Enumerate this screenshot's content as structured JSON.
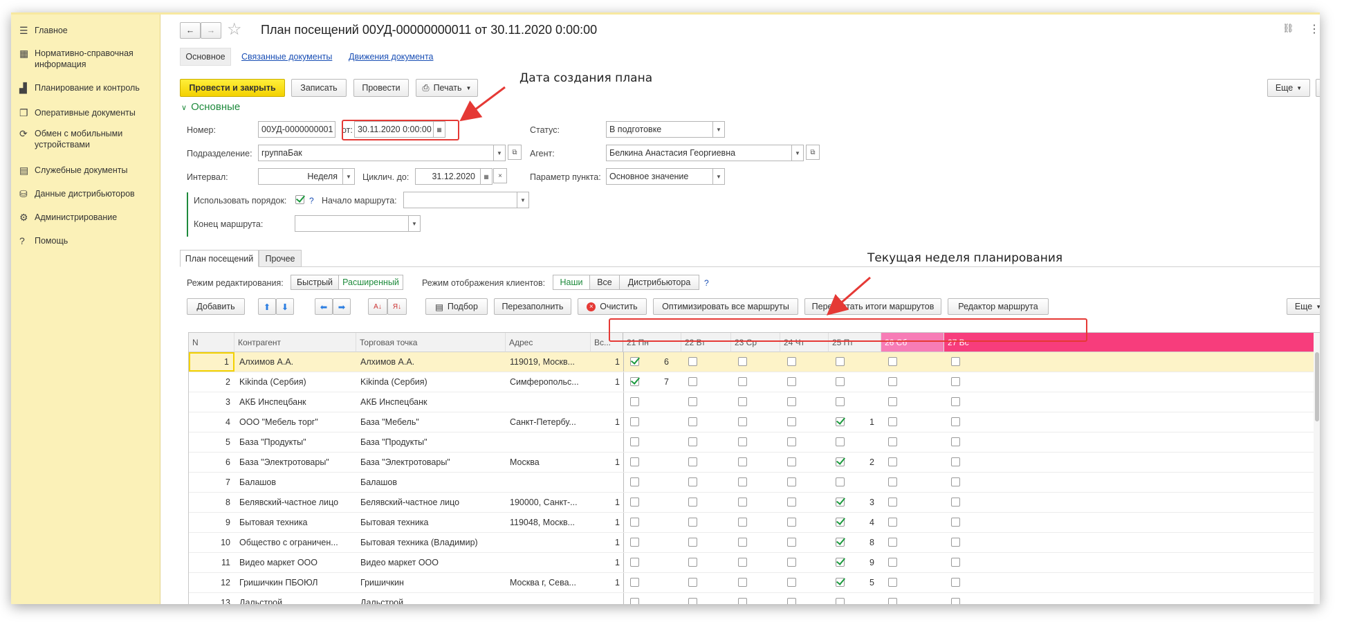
{
  "sidebar": {
    "items": [
      {
        "icon": "menu-icon",
        "glyph": "☰",
        "label": "Главное"
      },
      {
        "icon": "grid-icon",
        "glyph": "▦",
        "label": "Нормативно-справочная информация"
      },
      {
        "icon": "chart-icon",
        "glyph": "▟",
        "label": "Планирование и контроль"
      },
      {
        "icon": "documents-icon",
        "glyph": "❐",
        "label": "Оперативные документы"
      },
      {
        "icon": "sync-icon",
        "glyph": "⟳",
        "label": "Обмен с мобильными устройствами"
      },
      {
        "icon": "service-docs-icon",
        "glyph": "▤",
        "label": "Служебные документы"
      },
      {
        "icon": "distributor-icon",
        "glyph": "⛁",
        "label": "Данные дистрибьюторов"
      },
      {
        "icon": "gear-icon",
        "glyph": "⚙",
        "label": "Администрирование"
      },
      {
        "icon": "help-icon",
        "glyph": "?",
        "label": "Помощь"
      }
    ]
  },
  "header": {
    "title": "План посещений 00УД-00000000011 от 30.11.2020 0:00:00",
    "back_glyph": "←",
    "forward_glyph": "→",
    "star_glyph": "☆",
    "link_glyph": "🔗",
    "more_glyph": "⋮",
    "close_glyph": "×"
  },
  "doc_tabs": {
    "main": "Основное",
    "linked": "Связанные документы",
    "movements": "Движения документа"
  },
  "toolbar": {
    "post_close": "Провести и закрыть",
    "save": "Записать",
    "post": "Провести",
    "print": "Печать",
    "more": "Еще",
    "help": "?"
  },
  "section": {
    "title": "Основные"
  },
  "form": {
    "number_label": "Номер:",
    "number_value": "00УД-0000000001",
    "from_label": "от:",
    "date_value": "30.11.2020  0:00:00",
    "status_label": "Статус:",
    "status_value": "В подготовке",
    "department_label": "Подразделение:",
    "department_value": "группаБак",
    "agent_label": "Агент:",
    "agent_value": "Белкина Анастасия Георгиевна",
    "interval_label": "Интервал:",
    "interval_value": "Неделя",
    "cyclic_label": "Циклич. до:",
    "cyclic_value": "31.12.2020",
    "point_param_label": "Параметр пункта:",
    "point_param_value": "Основное значение",
    "use_order_label": "Использовать порядок:",
    "use_order_help": "?",
    "route_start_label": "Начало маршрута:",
    "route_end_label": "Конец маршрута:"
  },
  "plan_tabs": {
    "visits": "План посещений",
    "other": "Прочее"
  },
  "modes": {
    "edit_label": "Режим редактирования:",
    "edit_fast": "Быстрый",
    "edit_extended": "Расширенный",
    "display_label": "Режим отображения клиентов:",
    "display_ours": "Наши",
    "display_all": "Все",
    "display_distributor": "Дистрибьютора",
    "help": "?"
  },
  "table_toolbar": {
    "add": "Добавить",
    "selection": "Подбор",
    "refill": "Перезаполнить",
    "clear": "Очистить",
    "optimize": "Оптимизировать все маршруты",
    "recalc": "Пересчитать итоги маршрутов",
    "route_editor": "Редактор маршрута",
    "more": "Еще"
  },
  "columns": {
    "n": "N",
    "counterparty": "Контрагент",
    "outlet": "Торговая точка",
    "address": "Адрес",
    "total": "Вс..."
  },
  "days": [
    "21 Пн",
    "22 Вт",
    "23 Ср",
    "24 Чт",
    "25 Пт",
    "26 Сб",
    "27 Вс"
  ],
  "colors": {
    "saturday": "#f77cb6",
    "sunday": "#f73d7c",
    "accent": "#1e8a3c",
    "yellow": "#f3d100",
    "annotation": "#e53935"
  },
  "rows": [
    {
      "n": "1",
      "counterparty": "Алхимов А.А.",
      "outlet": "Алхимов А.А.",
      "address": "119019, Москв...",
      "total": "1",
      "checks": [
        true,
        false,
        false,
        false,
        false,
        false,
        false
      ],
      "order": "6"
    },
    {
      "n": "2",
      "counterparty": "Kikinda (Сербия)",
      "outlet": "Kikinda (Сербия)",
      "address": "Симферопольс...",
      "total": "1",
      "checks": [
        true,
        false,
        false,
        false,
        false,
        false,
        false
      ],
      "order": "7"
    },
    {
      "n": "3",
      "counterparty": "АКБ Инспецбанк",
      "outlet": "АКБ Инспецбанк",
      "address": "",
      "total": "",
      "checks": [
        false,
        false,
        false,
        false,
        false,
        false,
        false
      ],
      "order": ""
    },
    {
      "n": "4",
      "counterparty": "ООО \"Мебель торг\"",
      "outlet": "База \"Мебель\"",
      "address": "Санкт-Петербу...",
      "total": "1",
      "checks": [
        false,
        false,
        false,
        false,
        true,
        false,
        false
      ],
      "order": "1"
    },
    {
      "n": "5",
      "counterparty": "База \"Продукты\"",
      "outlet": "База \"Продукты\"",
      "address": "",
      "total": "",
      "checks": [
        false,
        false,
        false,
        false,
        false,
        false,
        false
      ],
      "order": ""
    },
    {
      "n": "6",
      "counterparty": "База \"Электротовары\"",
      "outlet": "База \"Электротовары\"",
      "address": "Москва",
      "total": "1",
      "checks": [
        false,
        false,
        false,
        false,
        true,
        false,
        false
      ],
      "order": "2"
    },
    {
      "n": "7",
      "counterparty": "Балашов",
      "outlet": "Балашов",
      "address": "",
      "total": "",
      "checks": [
        false,
        false,
        false,
        false,
        false,
        false,
        false
      ],
      "order": ""
    },
    {
      "n": "8",
      "counterparty": "Белявский-частное лицо",
      "outlet": "Белявский-частное лицо",
      "address": "190000, Санкт-...",
      "total": "1",
      "checks": [
        false,
        false,
        false,
        false,
        true,
        false,
        false
      ],
      "order": "3"
    },
    {
      "n": "9",
      "counterparty": "Бытовая техника",
      "outlet": "Бытовая техника",
      "address": "119048, Москв...",
      "total": "1",
      "checks": [
        false,
        false,
        false,
        false,
        true,
        false,
        false
      ],
      "order": "4"
    },
    {
      "n": "10",
      "counterparty": "Общество с ограничен...",
      "outlet": "Бытовая техника (Владимир)",
      "address": "",
      "total": "1",
      "checks": [
        false,
        false,
        false,
        false,
        true,
        false,
        false
      ],
      "order": "8"
    },
    {
      "n": "11",
      "counterparty": "Видео маркет ООО",
      "outlet": "Видео маркет ООО",
      "address": "",
      "total": "1",
      "checks": [
        false,
        false,
        false,
        false,
        true,
        false,
        false
      ],
      "order": "9"
    },
    {
      "n": "12",
      "counterparty": "Гришичкин ПБОЮЛ",
      "outlet": "Гришичкин",
      "address": "Москва г, Сева...",
      "total": "1",
      "checks": [
        false,
        false,
        false,
        false,
        true,
        false,
        false
      ],
      "order": "5"
    },
    {
      "n": "13",
      "counterparty": "Дальстрой",
      "outlet": "Дальстрой",
      "address": "",
      "total": "",
      "checks": [
        false,
        false,
        false,
        false,
        false,
        false,
        false
      ],
      "order": ""
    }
  ],
  "annotations": {
    "date": "Дата создания плана",
    "week": "Текущая неделя планирования"
  }
}
